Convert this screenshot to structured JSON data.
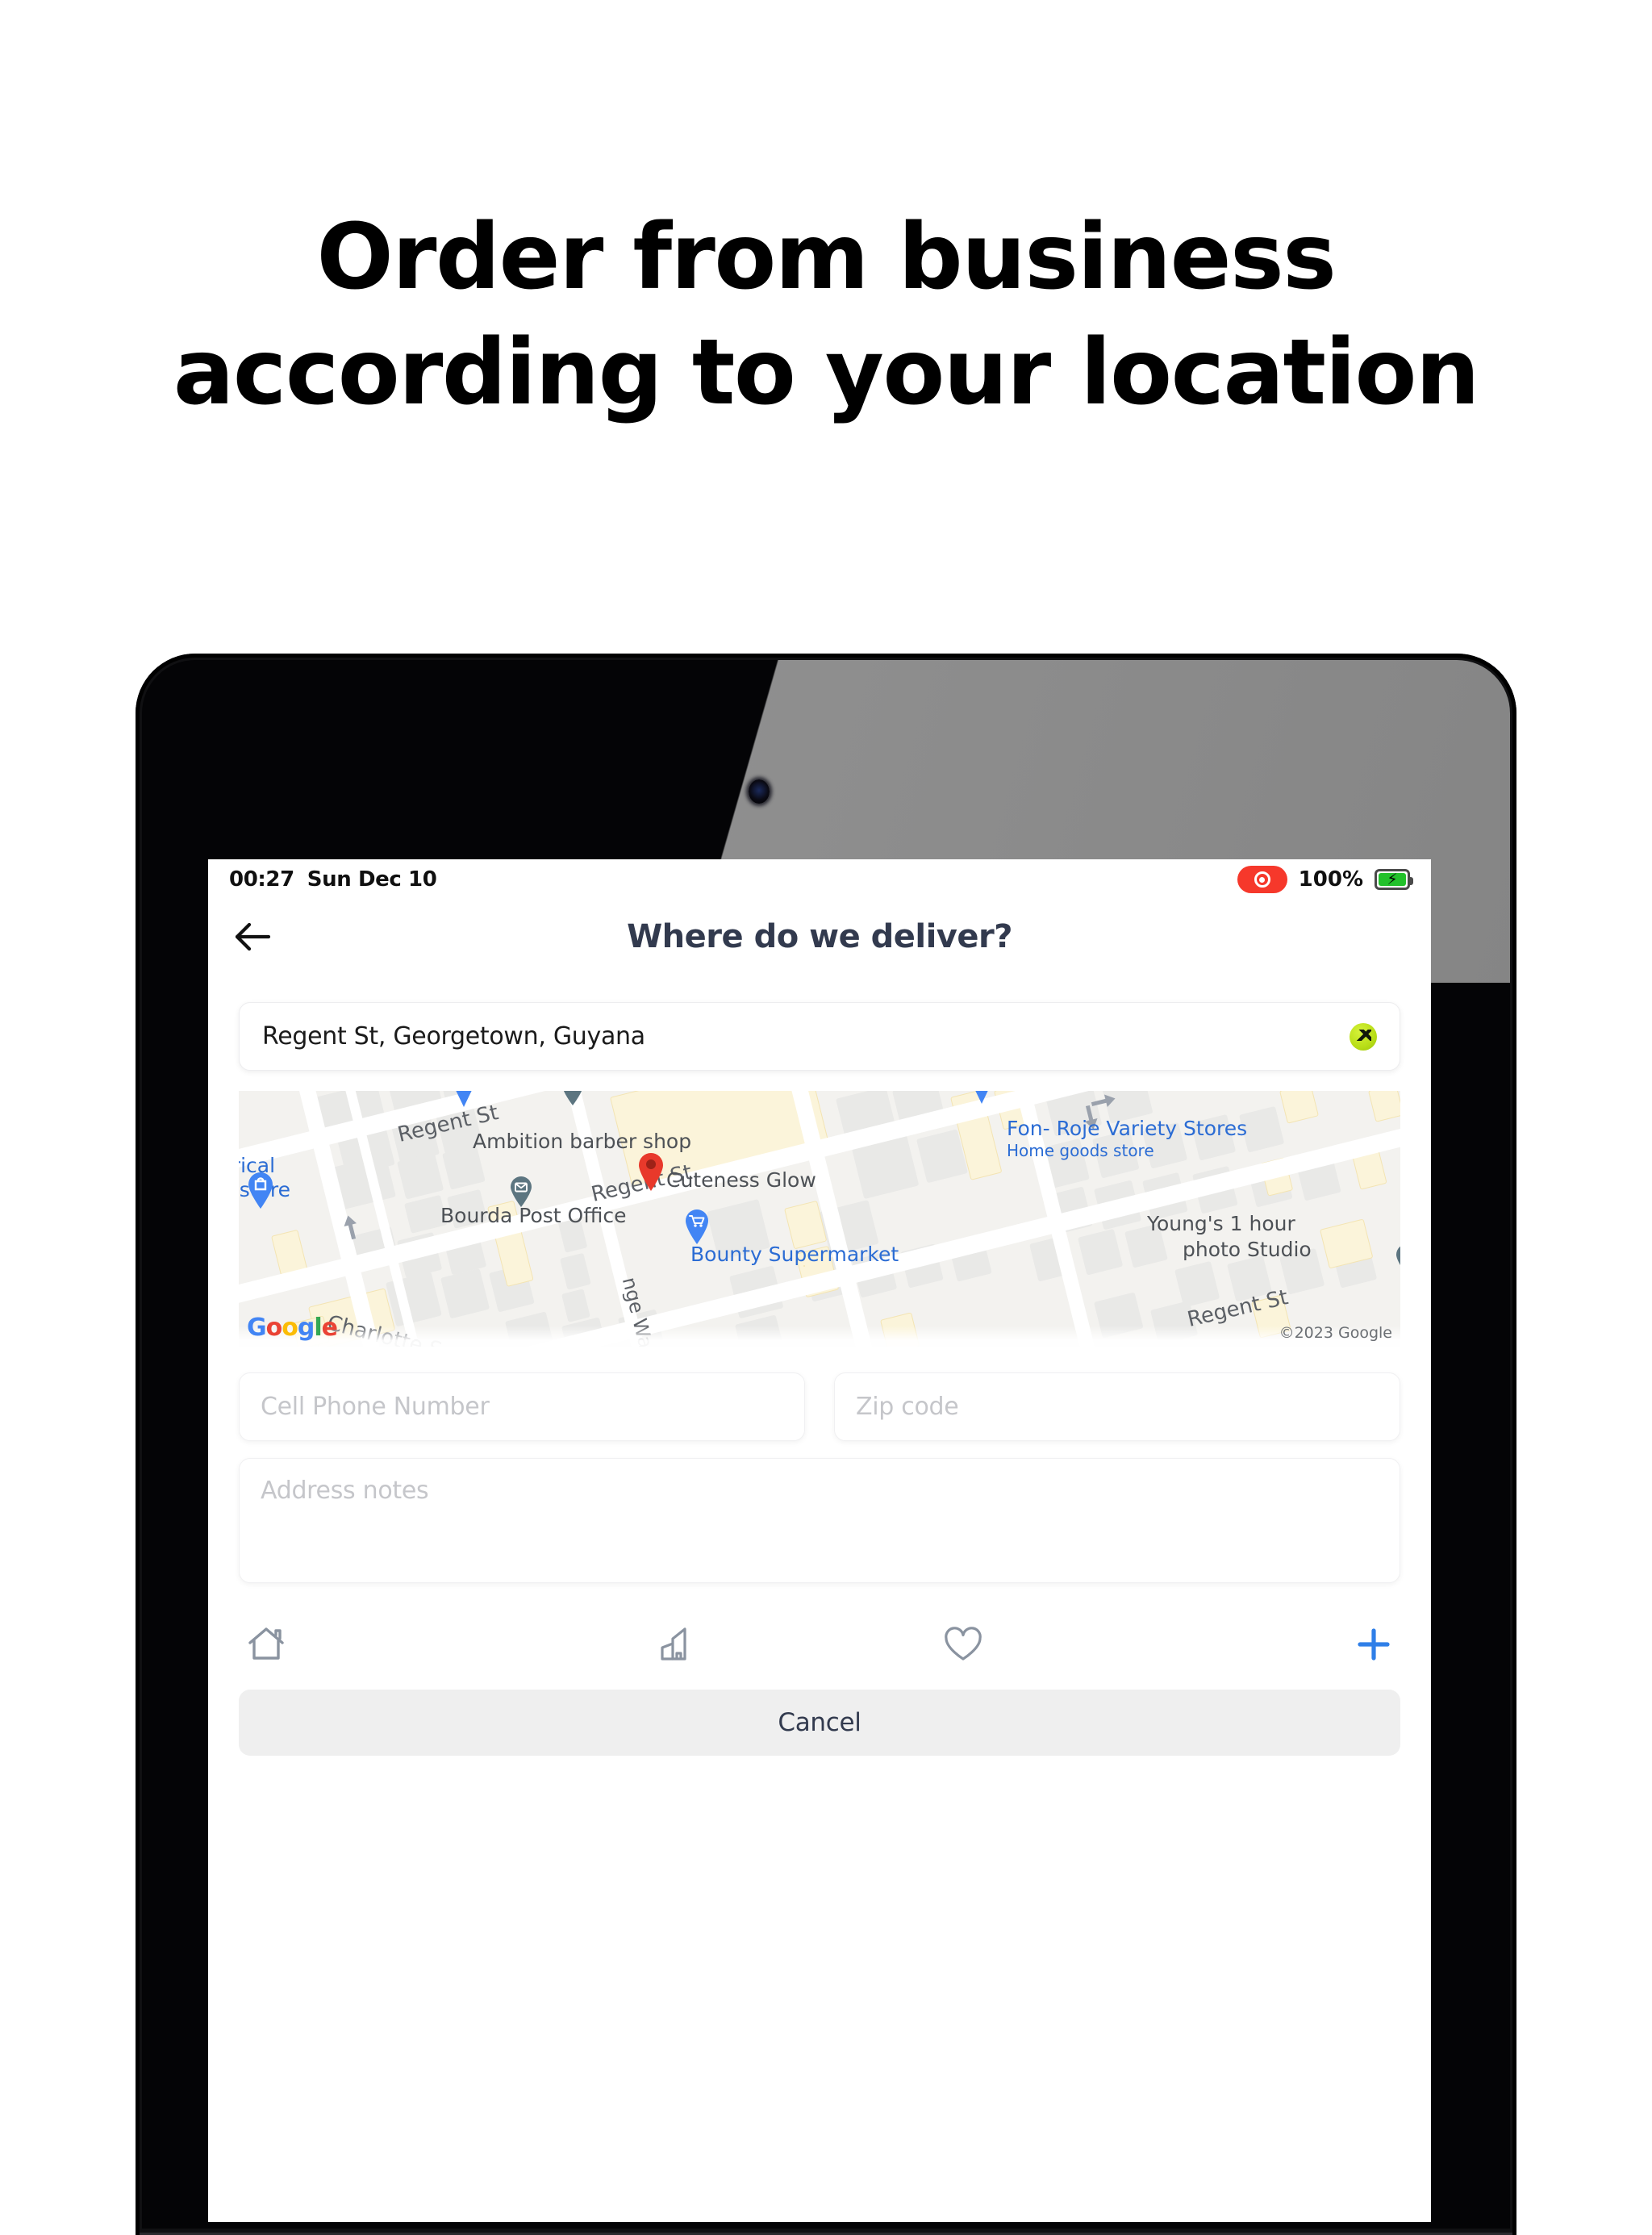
{
  "marketing": {
    "headline_line1": "Order from business",
    "headline_line2": "according to your location"
  },
  "status_bar": {
    "time": "00:27",
    "date": "Sun Dec 10",
    "battery_percent": "100%",
    "recording_indicator": "screen-record-icon",
    "battery_icon": "battery-charging-icon"
  },
  "header": {
    "back_icon": "arrow-left-icon",
    "title": "Where do we deliver?"
  },
  "address": {
    "value": "Regent St, Georgetown, Guyana",
    "badge_icon": "app-logo-badge"
  },
  "map": {
    "attribution": "©2023 Google",
    "google_logo": {
      "g1": "G",
      "o1": "o",
      "o2": "o",
      "g2": "g",
      "l1": "l",
      "e1": "e"
    },
    "streets": [
      {
        "name": "Regent St"
      },
      {
        "name": "Regent St"
      },
      {
        "name": "Regent St"
      },
      {
        "name": "Charlotte St"
      },
      {
        "name": "nge Walk"
      }
    ],
    "labels": {
      "regent_st_1": "Regent St",
      "regent_st_2": "Regent St",
      "regent_st_3": "Regent St",
      "charlotte_st": "Charlotte S",
      "orange_walk": "nge Walk",
      "electrical_1": "trical",
      "electrical_2": "y store",
      "ambition_barber": "Ambition barber shop",
      "bourda_post_office": "Bourda Post Office",
      "cuteness_glow": "Cuteness Glow",
      "bounty_supermarket": "Bounty Supermarket",
      "fon_roje": "Fon- Roje Variety Stores",
      "fon_roje_sub": "Home goods store",
      "youngs_photo_1": "Young's 1 hour",
      "youngs_photo_2": "photo Studio"
    },
    "pins": [
      {
        "name": "shopping-bag-pin",
        "color": "#4285F4"
      },
      {
        "name": "selected-location-pin",
        "color": "#E8392B"
      },
      {
        "name": "mail-pin",
        "color": "#5C7580"
      },
      {
        "name": "shopping-cart-pin",
        "color": "#4285F4"
      },
      {
        "name": "generic-place-pin",
        "color": "#5C7580"
      },
      {
        "name": "marker-pin-blue",
        "color": "#4285F4"
      }
    ]
  },
  "form": {
    "phone_placeholder": "Cell Phone Number",
    "phone_value": "",
    "zip_placeholder": "Zip code",
    "zip_value": "",
    "notes_placeholder": "Address notes",
    "notes_value": ""
  },
  "label_options": [
    {
      "id": "home",
      "icon": "home-icon",
      "color": "#8A93A0"
    },
    {
      "id": "office",
      "icon": "office-building-icon",
      "color": "#8A93A0"
    },
    {
      "id": "favorite",
      "icon": "heart-icon",
      "color": "#8A93A0"
    },
    {
      "id": "add",
      "icon": "plus-icon",
      "color": "#2F7FE8"
    }
  ],
  "actions": {
    "cancel_label": "Cancel"
  },
  "colors": {
    "title": "#323A4E",
    "accent_blue": "#2F7FE8",
    "record_red": "#F6382B",
    "battery_green": "#22C12B",
    "placeholder": "#C5C6CA",
    "cancel_bg": "#EFEFEF",
    "brand_green": "#B7DD16"
  }
}
